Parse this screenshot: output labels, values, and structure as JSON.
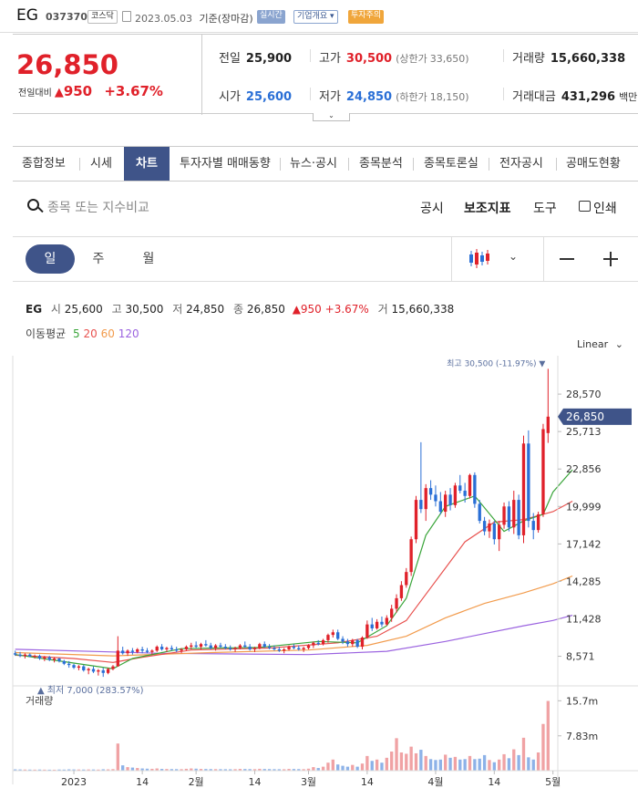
{
  "header": {
    "name": "EG",
    "code": "037370",
    "market": "코스닥",
    "date": "2023.05.03",
    "basis": "기준(장마감)",
    "realtime": "실시간",
    "overview": "기업개요 ▾",
    "warning": "투자주의"
  },
  "summary": {
    "price": "26,850",
    "change_label": "전일대비",
    "change_arrow": "▲",
    "change": "950",
    "change_pct": "+3.67%",
    "prev_label": "전일",
    "prev": "25,900",
    "high_label": "고가",
    "high": "30,500",
    "upper_label": "(상한가",
    "upper": "33,650)",
    "volume_label": "거래량",
    "volume": "15,660,338",
    "open_label": "시가",
    "open": "25,600",
    "low_label": "저가",
    "low": "24,850",
    "lower_label": "(하한가",
    "lower": "18,150)",
    "amount_label": "거래대금",
    "amount": "431,296",
    "amount_unit": "백만"
  },
  "nav": [
    "종합정보",
    "시세",
    "차트",
    "투자자별 매매동향",
    "뉴스·공시",
    "종목분석",
    "종목토론실",
    "전자공시",
    "공매도현황"
  ],
  "nav_active": "차트",
  "toolbar": {
    "search_placeholder": "종목 또는 지수비교",
    "disclosure": "공시",
    "indicators": "보조지표",
    "tools": "도구",
    "print": "인쇄"
  },
  "periods": [
    "일",
    "주",
    "월"
  ],
  "period_active": "일",
  "chart_info": {
    "name": "EG",
    "open_k": "시",
    "open": "25,600",
    "high_k": "고",
    "high": "30,500",
    "low_k": "저",
    "low": "24,850",
    "close_k": "종",
    "close": "26,850",
    "change": "▲950 +3.67%",
    "vol_k": "거",
    "vol": "15,660,338",
    "ma_label": "이동평균",
    "ma": [
      {
        "label": "5",
        "color": "#3aa53a"
      },
      {
        "label": "20",
        "color": "#e8514e"
      },
      {
        "label": "60",
        "color": "#f29b4c"
      },
      {
        "label": "120",
        "color": "#9b63e0"
      }
    ],
    "scale": "Linear"
  },
  "chart_data": {
    "type": "candlestick",
    "title": "",
    "y_ticks": [
      "28,570",
      "25,713",
      "22,856",
      "19,999",
      "17,142",
      "14,285",
      "11,428",
      "8,571"
    ],
    "y_tick_values": [
      28570,
      25713,
      22856,
      19999,
      17142,
      14285,
      11428,
      8571
    ],
    "ylim": [
      6800,
      31500
    ],
    "x_labels": [
      {
        "label": "2023",
        "day": 12
      },
      {
        "label": "14",
        "day": 26
      },
      {
        "label": "2월",
        "day": 37
      },
      {
        "label": "14",
        "day": 49
      },
      {
        "label": "3월",
        "day": 60
      },
      {
        "label": "14",
        "day": 72
      },
      {
        "label": "4월",
        "day": 86
      },
      {
        "label": "14",
        "day": 98
      },
      {
        "label": "5월",
        "day": 110
      }
    ],
    "current_price": 26850,
    "current_label": "26,850",
    "max_label": "최고 30,500 (-11.97%)",
    "max_marker": "▼",
    "max_value": 30500,
    "min_label": "최저 7,000 (283.57%)",
    "min_marker": "▲",
    "min_value": 7000,
    "ma_colors": {
      "ma5": "#3aa53a",
      "ma20": "#e8514e",
      "ma60": "#f29b4c",
      "ma120": "#9b63e0"
    },
    "candles": [
      [
        8800,
        9000,
        8600,
        8700
      ],
      [
        8700,
        8900,
        8500,
        8600
      ],
      [
        8600,
        8800,
        8400,
        8700
      ],
      [
        8700,
        8800,
        8500,
        8550
      ],
      [
        8550,
        8700,
        8400,
        8600
      ],
      [
        8600,
        8700,
        8300,
        8400
      ],
      [
        8400,
        8600,
        8200,
        8500
      ],
      [
        8500,
        8600,
        8200,
        8300
      ],
      [
        8300,
        8500,
        8100,
        8400
      ],
      [
        8400,
        8450,
        8100,
        8200
      ],
      [
        8200,
        8300,
        7900,
        8000
      ],
      [
        8000,
        8200,
        7700,
        7900
      ],
      [
        7900,
        8000,
        7600,
        7700
      ],
      [
        7700,
        7900,
        7500,
        7800
      ],
      [
        7800,
        7900,
        7400,
        7500
      ],
      [
        7500,
        7700,
        7200,
        7600
      ],
      [
        7600,
        7800,
        7300,
        7400
      ],
      [
        7400,
        7600,
        7100,
        7500
      ],
      [
        7500,
        7700,
        7000,
        7300
      ],
      [
        7300,
        7700,
        7200,
        7600
      ],
      [
        7600,
        7900,
        7500,
        7800
      ],
      [
        7800,
        10100,
        7800,
        9000
      ],
      [
        9000,
        9300,
        8700,
        8800
      ],
      [
        8800,
        9100,
        8600,
        9000
      ],
      [
        9000,
        9200,
        8700,
        8900
      ],
      [
        8900,
        9200,
        8800,
        9100
      ],
      [
        9100,
        9300,
        8800,
        9000
      ],
      [
        9000,
        9200,
        8800,
        8900
      ],
      [
        8900,
        9100,
        8700,
        9000
      ],
      [
        9000,
        9400,
        8900,
        9300
      ],
      [
        9300,
        9500,
        9000,
        9100
      ],
      [
        9100,
        9300,
        8900,
        9200
      ],
      [
        9200,
        9400,
        9000,
        9100
      ],
      [
        9100,
        9300,
        8900,
        9000
      ],
      [
        9000,
        9200,
        8800,
        9100
      ],
      [
        9100,
        9400,
        9000,
        9300
      ],
      [
        9300,
        9600,
        9100,
        9400
      ],
      [
        9400,
        9700,
        9200,
        9300
      ],
      [
        9300,
        9600,
        9100,
        9500
      ],
      [
        9500,
        9800,
        9300,
        9400
      ],
      [
        9400,
        9600,
        9100,
        9200
      ],
      [
        9200,
        9500,
        9000,
        9400
      ],
      [
        9400,
        9600,
        9200,
        9300
      ],
      [
        9300,
        9500,
        9100,
        9200
      ],
      [
        9200,
        9400,
        9000,
        9100
      ],
      [
        9100,
        9300,
        8900,
        9200
      ],
      [
        9200,
        9500,
        9100,
        9400
      ],
      [
        9400,
        9700,
        9200,
        9300
      ],
      [
        9300,
        9500,
        9000,
        9100
      ],
      [
        9100,
        9300,
        8900,
        9200
      ],
      [
        9200,
        9600,
        9100,
        9500
      ],
      [
        9500,
        9700,
        9200,
        9300
      ],
      [
        9300,
        9500,
        9100,
        9200
      ],
      [
        9200,
        9400,
        9000,
        9100
      ],
      [
        9100,
        9300,
        8900,
        9000
      ],
      [
        9000,
        9200,
        8800,
        9100
      ],
      [
        9100,
        9400,
        9000,
        9300
      ],
      [
        9300,
        9500,
        9100,
        9200
      ],
      [
        9200,
        9400,
        9000,
        9100
      ],
      [
        9100,
        9300,
        8900,
        9200
      ],
      [
        9200,
        9500,
        9100,
        9400
      ],
      [
        9400,
        9700,
        9200,
        9600
      ],
      [
        9600,
        9800,
        9400,
        9500
      ],
      [
        9500,
        9900,
        9400,
        9800
      ],
      [
        9800,
        10300,
        9600,
        10200
      ],
      [
        10200,
        10600,
        10000,
        10400
      ],
      [
        10400,
        10600,
        9800,
        9900
      ],
      [
        9900,
        10100,
        9500,
        9700
      ],
      [
        9700,
        9900,
        9300,
        9500
      ],
      [
        9500,
        9900,
        9300,
        9800
      ],
      [
        9800,
        9900,
        9200,
        9300
      ],
      [
        9300,
        10100,
        9100,
        10000
      ],
      [
        10000,
        11300,
        9900,
        11000
      ],
      [
        11000,
        11500,
        10500,
        10700
      ],
      [
        10700,
        11400,
        10600,
        11200
      ],
      [
        11200,
        11600,
        10800,
        11000
      ],
      [
        11000,
        11700,
        10900,
        11500
      ],
      [
        11500,
        12500,
        11200,
        12200
      ],
      [
        12200,
        13300,
        11900,
        13000
      ],
      [
        13000,
        14300,
        12800,
        14000
      ],
      [
        14000,
        15300,
        13800,
        15000
      ],
      [
        15000,
        17700,
        14700,
        17500
      ],
      [
        17500,
        20800,
        17200,
        20500
      ],
      [
        20500,
        24900,
        19500,
        19800
      ],
      [
        19800,
        21700,
        18900,
        21400
      ],
      [
        21400,
        22000,
        20500,
        20900
      ],
      [
        20900,
        21600,
        20000,
        20400
      ],
      [
        20400,
        21100,
        19400,
        19600
      ],
      [
        19600,
        21200,
        19200,
        20900
      ],
      [
        20900,
        21400,
        19700,
        20100
      ],
      [
        20100,
        21800,
        19900,
        21600
      ],
      [
        21600,
        22400,
        21000,
        21200
      ],
      [
        21200,
        21800,
        20300,
        20800
      ],
      [
        20800,
        22500,
        20600,
        22400
      ],
      [
        22400,
        22600,
        19900,
        20200
      ],
      [
        20200,
        20500,
        18700,
        18900
      ],
      [
        18900,
        19200,
        17800,
        18100
      ],
      [
        18100,
        19000,
        17600,
        18700
      ],
      [
        18700,
        18900,
        17100,
        17500
      ],
      [
        17500,
        18900,
        16600,
        18600
      ],
      [
        18600,
        20300,
        18300,
        20000
      ],
      [
        20000,
        20400,
        18100,
        18400
      ],
      [
        18400,
        21200,
        17900,
        20500
      ],
      [
        20500,
        20900,
        17500,
        17800
      ],
      [
        17800,
        25400,
        17200,
        24800
      ],
      [
        24800,
        25800,
        18400,
        18900
      ],
      [
        18900,
        19500,
        17500,
        18200
      ],
      [
        18200,
        19600,
        18000,
        19400
      ],
      [
        19400,
        26300,
        19200,
        25900
      ],
      [
        25600,
        30500,
        24850,
        26850
      ]
    ],
    "ma5": [
      [
        0,
        8700
      ],
      [
        12,
        8050
      ],
      [
        20,
        7620
      ],
      [
        24,
        8400
      ],
      [
        34,
        9150
      ],
      [
        50,
        9250
      ],
      [
        62,
        9700
      ],
      [
        70,
        9600
      ],
      [
        76,
        10900
      ],
      [
        80,
        13000
      ],
      [
        84,
        17800
      ],
      [
        88,
        20000
      ],
      [
        94,
        20800
      ],
      [
        100,
        18100
      ],
      [
        104,
        18900
      ],
      [
        108,
        19400
      ],
      [
        110,
        21100
      ],
      [
        114,
        22800
      ]
    ],
    "ma20": [
      [
        0,
        8650
      ],
      [
        12,
        8400
      ],
      [
        20,
        8100
      ],
      [
        26,
        8500
      ],
      [
        36,
        9050
      ],
      [
        52,
        9200
      ],
      [
        66,
        9600
      ],
      [
        74,
        10100
      ],
      [
        80,
        11300
      ],
      [
        86,
        14300
      ],
      [
        92,
        17300
      ],
      [
        98,
        18800
      ],
      [
        104,
        19000
      ],
      [
        110,
        19600
      ],
      [
        114,
        20400
      ]
    ],
    "ma60": [
      [
        0,
        8850
      ],
      [
        20,
        8600
      ],
      [
        40,
        8850
      ],
      [
        60,
        9050
      ],
      [
        72,
        9400
      ],
      [
        80,
        10100
      ],
      [
        88,
        11500
      ],
      [
        96,
        12600
      ],
      [
        104,
        13400
      ],
      [
        110,
        14100
      ],
      [
        114,
        14700
      ]
    ],
    "ma120": [
      [
        0,
        9100
      ],
      [
        30,
        8800
      ],
      [
        60,
        8700
      ],
      [
        76,
        8950
      ],
      [
        88,
        9700
      ],
      [
        96,
        10300
      ],
      [
        104,
        10900
      ],
      [
        110,
        11300
      ],
      [
        114,
        11700
      ]
    ],
    "volume": {
      "label": "거래량",
      "y_ticks": [
        "15.7m",
        "7.83m"
      ],
      "y_tick_values": [
        15700000,
        7830000
      ],
      "max": 17000000,
      "values": [
        300000,
        280000,
        260000,
        250000,
        240000,
        260000,
        240000,
        230000,
        220000,
        260000,
        250000,
        300000,
        280000,
        270000,
        260000,
        280000,
        270000,
        250000,
        320000,
        300000,
        350000,
        6100000,
        1200000,
        800000,
        700000,
        600000,
        500000,
        450000,
        420000,
        500000,
        400000,
        380000,
        360000,
        350000,
        340000,
        420000,
        500000,
        450000,
        400000,
        380000,
        360000,
        350000,
        340000,
        330000,
        320000,
        340000,
        400000,
        380000,
        360000,
        340000,
        420000,
        380000,
        360000,
        340000,
        330000,
        320000,
        400000,
        380000,
        360000,
        340000,
        450000,
        800000,
        600000,
        900000,
        1800000,
        2500000,
        1400000,
        1100000,
        900000,
        1300000,
        900000,
        1600000,
        3300000,
        2200000,
        2500000,
        1800000,
        2900000,
        4300000,
        7300000,
        4100000,
        3800000,
        5400000,
        3900000,
        4700000,
        3300000,
        2600000,
        2400000,
        2500000,
        3600000,
        2900000,
        3100000,
        2500000,
        2600000,
        3300000,
        2600000,
        2700000,
        3500000,
        2400000,
        1900000,
        2500000,
        3700000,
        2800000,
        4800000,
        3500000,
        7400000,
        3000000,
        2500000,
        4100000,
        10500000,
        15660338
      ]
    }
  }
}
